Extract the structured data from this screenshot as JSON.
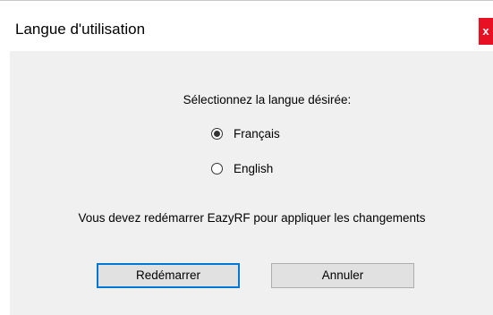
{
  "window": {
    "title": "Langue d'utilisation",
    "close_label": "x",
    "colors": {
      "close_button": "#e81123",
      "client_background": "#f0f0f0",
      "primary_button_border": "#0078d7"
    }
  },
  "dialog": {
    "prompt": "Sélectionnez la langue désirée:",
    "options": [
      {
        "label": "Français",
        "selected": true
      },
      {
        "label": "English",
        "selected": false
      }
    ],
    "notice": "Vous devez redémarrer EazyRF pour appliquer les changements",
    "buttons": {
      "restart": "Redémarrer",
      "cancel": "Annuler"
    }
  }
}
